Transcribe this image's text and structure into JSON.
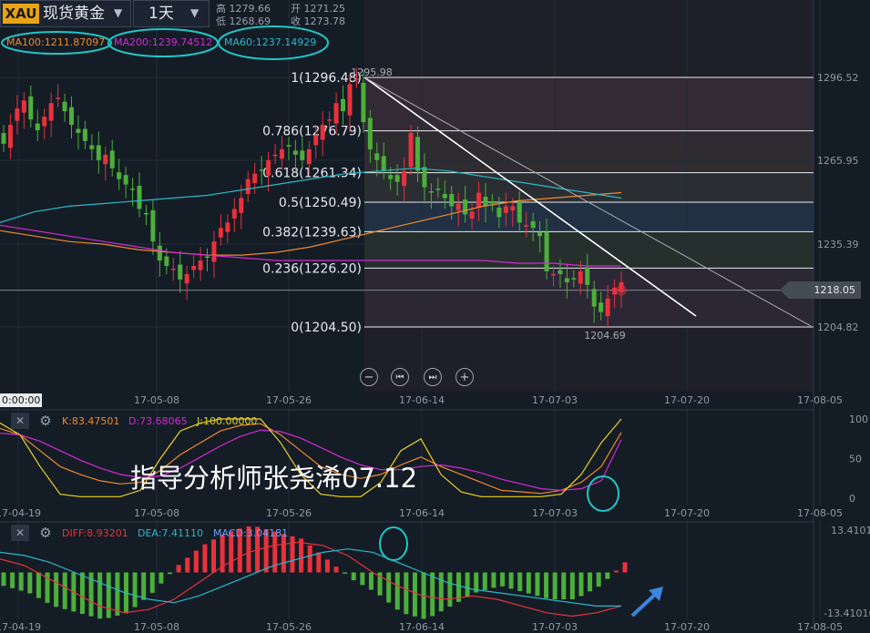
{
  "header": {
    "symbol_badge": "XAU",
    "symbol_name": "现货黄金",
    "period": "1天",
    "period_caret": "▼",
    "symbol_caret": "▼",
    "high_label": "高 1279.66",
    "low_label": "低 1268.69",
    "open_label": "开 1271.25",
    "close_label": "收 1273.78"
  },
  "ma_legend": {
    "ma100": "MA100:1211.87097",
    "ma200": "MA200:1239.74512",
    "ma60": "MA60:1237.14929"
  },
  "colors": {
    "up": "#e8323b",
    "down": "#4caf3a",
    "ma100": "#f08a2c",
    "ma200": "#d42ad4",
    "ma60": "#2bb8c8",
    "highlight": "#21c6c6",
    "background": "#141c26"
  },
  "fib_labels": [
    "1(1296.48)",
    "0.786(1276.79)",
    "0.618(1261.34)",
    "0.5(1250.49)",
    "0.382(1239.63)",
    "0.236(1226.20)",
    "0(1204.50)"
  ],
  "annotations": {
    "high_point": "1295.98",
    "low_point": "1204.69",
    "current_price": "1218.05",
    "time_corner": "0:00:00"
  },
  "price_axis": [
    "1296.52",
    "1265.95",
    "1235.39",
    "1204.82"
  ],
  "date_axis": [
    "17-04-19",
    "17-05-08",
    "17-05-26",
    "17-06-14",
    "17-07-03",
    "17-07-20",
    "17-08-05"
  ],
  "kdj": {
    "k": "K:83.47501",
    "d": "D:73.68065",
    "j": "J:100.00000",
    "axis": [
      "100",
      "50",
      "0"
    ]
  },
  "macd": {
    "diff": "DIFF:8.93201",
    "dea": "DEA:7.41110",
    "macd": "MACD:3.04181",
    "axis_top": "13.41016",
    "axis_bottom": "-13.41016"
  },
  "watermark": "指导分析师张尧浠07.12",
  "controls": {
    "zoom_out": "−",
    "prev": "⏮",
    "next": "⏭",
    "zoom_in": "+",
    "close": "✕",
    "settings": "⚙"
  },
  "chart_data": [
    {
      "type": "candlestick",
      "title": "现货黄金 1天",
      "x": [
        "17-04-19",
        "17-05-08",
        "17-05-26",
        "17-06-14",
        "17-07-03",
        "17-07-20",
        "17-08-05"
      ],
      "ylim": [
        1195,
        1305
      ],
      "candles_close": [
        1272,
        1279,
        1285,
        1288,
        1281,
        1277,
        1282,
        1287,
        1289,
        1284,
        1279,
        1276,
        1273,
        1270,
        1266,
        1268,
        1263,
        1259,
        1257,
        1255,
        1248,
        1246,
        1236,
        1229,
        1227,
        1226,
        1222,
        1224,
        1227,
        1229,
        1230,
        1236,
        1241,
        1243,
        1248,
        1252,
        1259,
        1261,
        1262,
        1266,
        1268,
        1270,
        1271,
        1268,
        1266,
        1270,
        1275,
        1279,
        1281,
        1287,
        1284,
        1294,
        1296,
        1280,
        1270,
        1266,
        1262,
        1259,
        1258,
        1262,
        1276,
        1262,
        1256,
        1254,
        1255,
        1252,
        1249,
        1250,
        1246,
        1247,
        1254,
        1249,
        1250,
        1245,
        1249,
        1249,
        1243,
        1242,
        1241,
        1238,
        1225,
        1224,
        1224,
        1221,
        1222,
        1225,
        1220,
        1212,
        1210,
        1215,
        1219,
        1221
      ],
      "series": [
        {
          "name": "MA100",
          "values": [
            1240,
            1238,
            1236,
            1235,
            1233,
            1232,
            1231,
            1231,
            1232,
            1234,
            1237,
            1240,
            1243,
            1246,
            1249,
            1251,
            1252,
            1253,
            1254
          ]
        },
        {
          "name": "MA200",
          "values": [
            1242,
            1240,
            1238,
            1236,
            1234,
            1232,
            1231,
            1230,
            1229,
            1229,
            1229,
            1229,
            1229,
            1229,
            1229,
            1228,
            1228,
            1227,
            1227
          ]
        },
        {
          "name": "MA60",
          "values": [
            1243,
            1247,
            1249,
            1250,
            1251,
            1252,
            1253,
            1255,
            1257,
            1259,
            1261,
            1262,
            1263,
            1262,
            1260,
            1258,
            1256,
            1254,
            1252
          ]
        }
      ],
      "fibonacci": [
        {
          "ratio": 1,
          "price": 1296.48
        },
        {
          "ratio": 0.786,
          "price": 1276.79
        },
        {
          "ratio": 0.618,
          "price": 1261.34
        },
        {
          "ratio": 0.5,
          "price": 1250.49
        },
        {
          "ratio": 0.382,
          "price": 1239.63
        },
        {
          "ratio": 0.236,
          "price": 1226.2
        },
        {
          "ratio": 0,
          "price": 1204.5
        }
      ],
      "last_price": 1218.05
    },
    {
      "type": "line",
      "title": "KDJ",
      "ylim": [
        0,
        100
      ],
      "series": [
        {
          "name": "K",
          "values": [
            88,
            80,
            60,
            40,
            30,
            22,
            18,
            20,
            35,
            55,
            70,
            85,
            92,
            94,
            80,
            60,
            40,
            30,
            25,
            30,
            42,
            52,
            40,
            30,
            20,
            10,
            8,
            6,
            10,
            20,
            40,
            83
          ]
        },
        {
          "name": "D",
          "values": [
            82,
            80,
            72,
            60,
            48,
            38,
            30,
            26,
            28,
            38,
            52,
            66,
            78,
            86,
            84,
            76,
            64,
            52,
            42,
            36,
            36,
            40,
            42,
            38,
            32,
            24,
            18,
            12,
            10,
            12,
            22,
            74
          ]
        },
        {
          "name": "J",
          "values": [
            95,
            80,
            40,
            5,
            2,
            2,
            2,
            10,
            50,
            85,
            95,
            100,
            100,
            100,
            70,
            30,
            5,
            2,
            2,
            20,
            60,
            75,
            30,
            8,
            2,
            2,
            2,
            2,
            5,
            30,
            70,
            100
          ]
        }
      ]
    },
    {
      "type": "bar",
      "title": "MACD",
      "ylim": [
        -13.41016,
        13.41016
      ],
      "series": [
        {
          "name": "DIFF",
          "values": [
            4,
            2,
            -2,
            -6,
            -10,
            -12,
            -11,
            -8,
            -3,
            2,
            6,
            8,
            9,
            8,
            5,
            0,
            -4,
            -7,
            -8,
            -7,
            -8,
            -10,
            -12,
            -13,
            -12,
            -10
          ]
        },
        {
          "name": "DEA",
          "values": [
            6,
            5,
            3,
            0,
            -3,
            -6,
            -8,
            -9,
            -7,
            -4,
            -1,
            2,
            4,
            6,
            7,
            6,
            3,
            0,
            -3,
            -5,
            -6,
            -7,
            -8,
            -9,
            -10,
            -10
          ]
        },
        {
          "name": "MACD",
          "values": [
            -4,
            -6,
            -10,
            -12,
            -14,
            -12,
            -6,
            2,
            8,
            12,
            14,
            12,
            10,
            4,
            -2,
            -6,
            -12,
            -14,
            -10,
            -6,
            -4,
            -6,
            -8,
            -8,
            -4,
            3
          ]
        }
      ]
    }
  ]
}
